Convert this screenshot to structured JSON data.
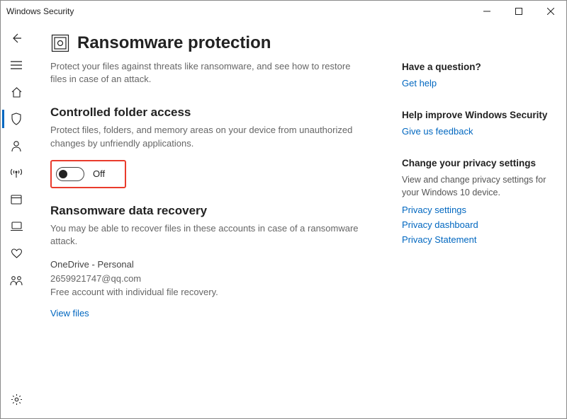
{
  "window": {
    "title": "Windows Security"
  },
  "page": {
    "title": "Ransomware protection",
    "description": "Protect your files against threats like ransomware, and see how to restore files in case of an attack."
  },
  "cfa": {
    "heading": "Controlled folder access",
    "description": "Protect files, folders, and memory areas on your device from unauthorized changes by unfriendly applications.",
    "toggle_label": "Off"
  },
  "recovery": {
    "heading": "Ransomware data recovery",
    "description": "You may be able to recover files in these accounts in case of a ransomware attack.",
    "account_name": "OneDrive - Personal",
    "account_email": "2659921747@qq.com",
    "account_note": "Free account with individual file recovery.",
    "view_files": "View files"
  },
  "aside": {
    "question_heading": "Have a question?",
    "get_help": "Get help",
    "improve_heading": "Help improve Windows Security",
    "feedback": "Give us feedback",
    "privacy_heading": "Change your privacy settings",
    "privacy_desc": "View and change privacy settings for your Windows 10 device.",
    "privacy_settings": "Privacy settings",
    "privacy_dashboard": "Privacy dashboard",
    "privacy_statement": "Privacy Statement"
  }
}
